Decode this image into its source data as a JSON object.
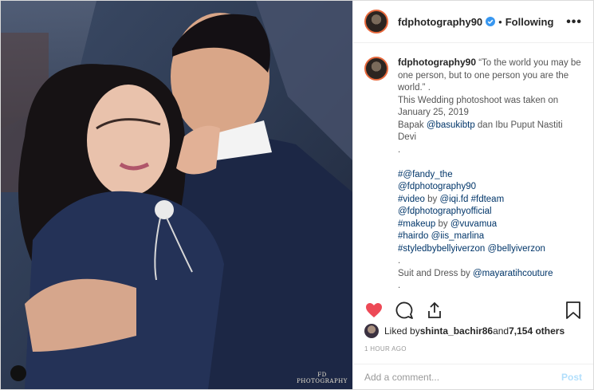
{
  "header": {
    "username": "fdphotography90",
    "dot": "•",
    "following": "Following",
    "more": "•••"
  },
  "caption": {
    "username": "fdphotography90",
    "line1": "“To the world you may be one person, but to one person you are the world.” .",
    "line2": "This Wedding photoshoot was taken on January 25, 2019",
    "bapak": "Bapak ",
    "mention_basuki": "@basukibtp",
    "after_basuki": " dan Ibu Puput Nastiti Devi",
    "dot1": ".",
    "tag_fandy": "#@fandy_the",
    "mention_fd": "@fdphotography90",
    "video": "#video",
    "by1": " by ",
    "mention_iqi": "@iqi.fd",
    "tag_fdteam": " #fdteam",
    "mention_official": "@fdphotographyofficial",
    "makeup": "#makeup",
    "by2": " by ",
    "mention_vuva": "@vuvamua",
    "hairdo": "#hairdo",
    "mention_iis": " @iis_marlina",
    "styled": "#styledbybellyiverzon",
    "mention_belly": " @bellyiverzon",
    "dot2": ".",
    "suit": "Suit and Dress by ",
    "mention_maya": "@mayaratihcouture",
    "dot3": "."
  },
  "likes": {
    "prefix": "Liked by ",
    "user": "shinta_bachir86",
    "and": " and ",
    "count": "7,154 others"
  },
  "time": "1 HOUR AGO",
  "comment": {
    "placeholder": "Add a comment...",
    "post": "Post"
  },
  "watermark": "FD PHOTOGRAPHY",
  "colors": {
    "heart": "#ed4956",
    "link": "#003569",
    "post": "#b2dffc"
  }
}
